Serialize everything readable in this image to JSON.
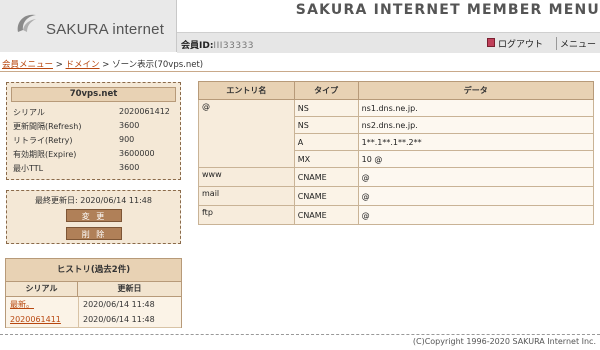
{
  "header": {
    "logo_text": "SAKURA internet",
    "menu_title": "SAKURA INTERNET MEMBER MENU",
    "member_id_label": "会員ID:",
    "member_id_value": "III33333",
    "logout_label": "ログアウト",
    "menu_label": "メニュー"
  },
  "breadcrumb": {
    "items": [
      "会員メニュー",
      "ドメイン"
    ],
    "separator": " > ",
    "current": "ゾーン表示(70vps.net)"
  },
  "soa": {
    "title": "70vps.net",
    "rows": [
      {
        "key": "シリアル",
        "value": "2020061412"
      },
      {
        "key": "更新間隔(Refresh)",
        "value": "3600"
      },
      {
        "key": "リトライ(Retry)",
        "value": "900"
      },
      {
        "key": "有効期限(Expire)",
        "value": "3600000"
      },
      {
        "key": "最小TTL",
        "value": "3600"
      }
    ]
  },
  "actions": {
    "last_updated": "最終更新日: 2020/06/14 11:48",
    "change_label": "変 更",
    "delete_label": "削 除"
  },
  "history": {
    "title": "ヒストリ(過去2件)",
    "col_serial": "シリアル",
    "col_updated": "更新日",
    "rows": [
      {
        "serial": "最新。",
        "updated": "2020/06/14 11:48"
      },
      {
        "serial": "2020061411",
        "updated": "2020/06/14 11:48"
      }
    ]
  },
  "zone": {
    "columns": [
      "エントリ名",
      "タイプ",
      "データ"
    ],
    "rows": [
      {
        "entry": "@",
        "type": "NS",
        "data": "ns1.dns.ne.jp."
      },
      {
        "entry": "",
        "type": "NS",
        "data": "ns2.dns.ne.jp."
      },
      {
        "entry": "",
        "type": "A",
        "data": "1**.1**.1**.2**"
      },
      {
        "entry": "",
        "type": "MX",
        "data": "10 @"
      },
      {
        "entry": "www",
        "type": "CNAME",
        "data": "@"
      },
      {
        "entry": "mail",
        "type": "CNAME",
        "data": "@"
      },
      {
        "entry": "ftp",
        "type": "CNAME",
        "data": "@"
      }
    ]
  },
  "footer": {
    "copyright": "(C)Copyright 1996-2020 SAKURA Internet Inc."
  },
  "colors": {
    "panel_bg": "#f4e8d6",
    "header_bg": "#e8d2b4",
    "link": "#b8470f",
    "button": "#b08058"
  }
}
